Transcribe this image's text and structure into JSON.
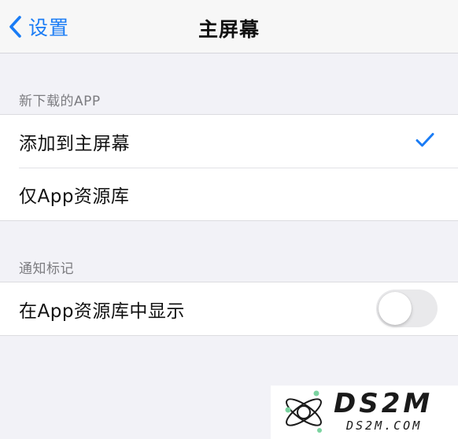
{
  "nav": {
    "back_label": "设置",
    "title": "主屏幕"
  },
  "new_downloads": {
    "header": "新下载的APP",
    "options": [
      {
        "label": "添加到主屏幕",
        "selected": true
      },
      {
        "label": "仅App资源库",
        "selected": false
      }
    ]
  },
  "notification_badges": {
    "header": "通知标记",
    "toggle_label": "在App资源库中显示",
    "toggle_on": false
  },
  "watermark": {
    "logo_text": "DS2M",
    "url_text": "DS2M.COM"
  },
  "colors": {
    "accent": "#1a7cf5",
    "background": "#f2f2f7",
    "toggle_off": "#e9e9eb",
    "watermark_ink": "#1a1a1a"
  }
}
